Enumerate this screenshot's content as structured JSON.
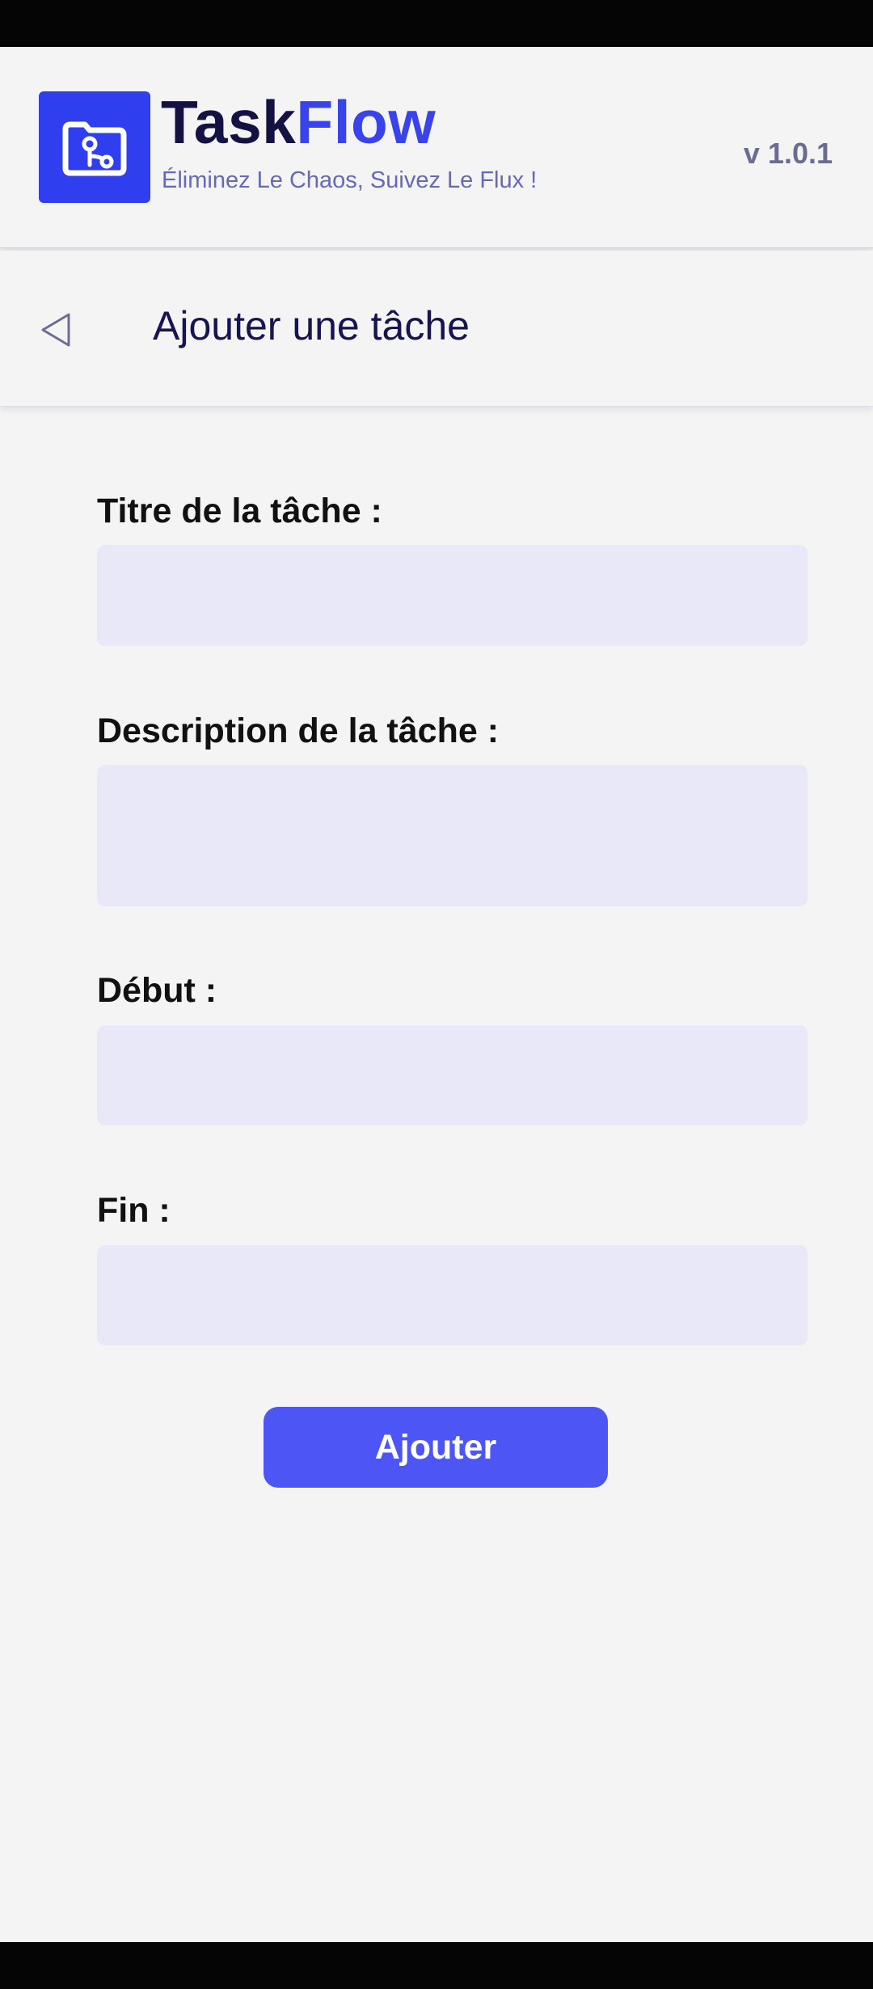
{
  "app": {
    "brand_part1": "Task",
    "brand_part2": "Flow",
    "tagline": "Éliminez Le Chaos, Suivez Le Flux !",
    "version": "v 1.0.1",
    "logo_icon": "folder-branch-icon",
    "accent_color": "#2f3ff0",
    "brand_dark_color": "#131242"
  },
  "screen": {
    "title": "Ajouter une tâche",
    "back_icon": "back-triangle-icon"
  },
  "form": {
    "title_label": "Titre de la tâche :",
    "title_value": "",
    "description_label": "Description de la tâche :",
    "description_value": "",
    "start_label": "Début :",
    "start_value": "",
    "end_label": "Fin :",
    "end_value": "",
    "input_bg_color": "#e8e8f8",
    "submit_label": "Ajouter",
    "submit_color": "#4d55f4"
  }
}
